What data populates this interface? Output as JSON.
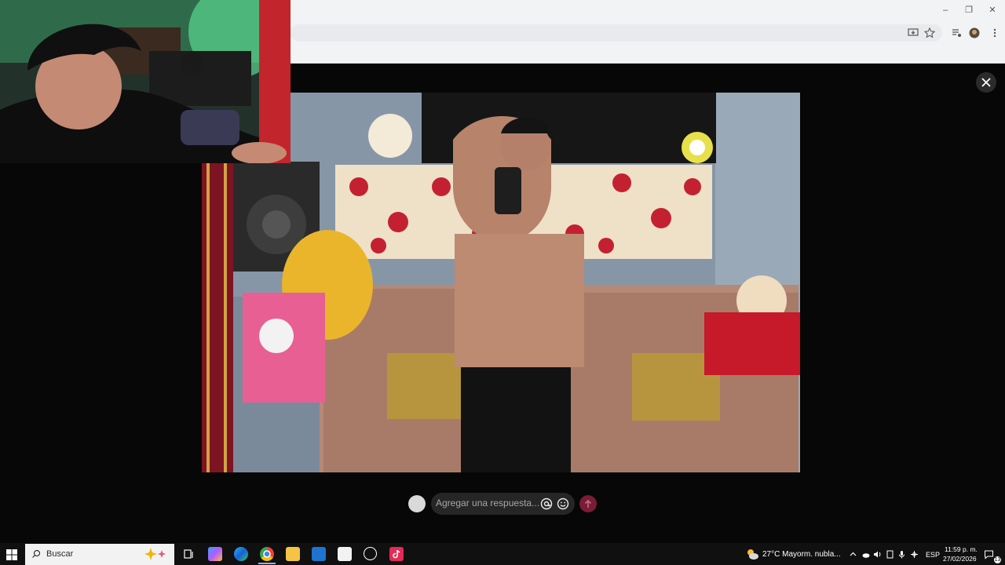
{
  "browser": {
    "window_controls": {
      "minimize": "–",
      "restore": "❐",
      "close": "✕"
    }
  },
  "reply_bar": {
    "placeholder": "Agregar una respuesta..."
  },
  "taskbar": {
    "search_label": "Buscar",
    "weather": "27°C  Mayorm. nubla...",
    "language": "ESP",
    "time": "11:59 p. m.",
    "date": "27/02/2026",
    "notification_count": "13"
  },
  "colors": {
    "accent": "#7a1c35",
    "overlay": "#070707",
    "taskbar": "#101010"
  }
}
